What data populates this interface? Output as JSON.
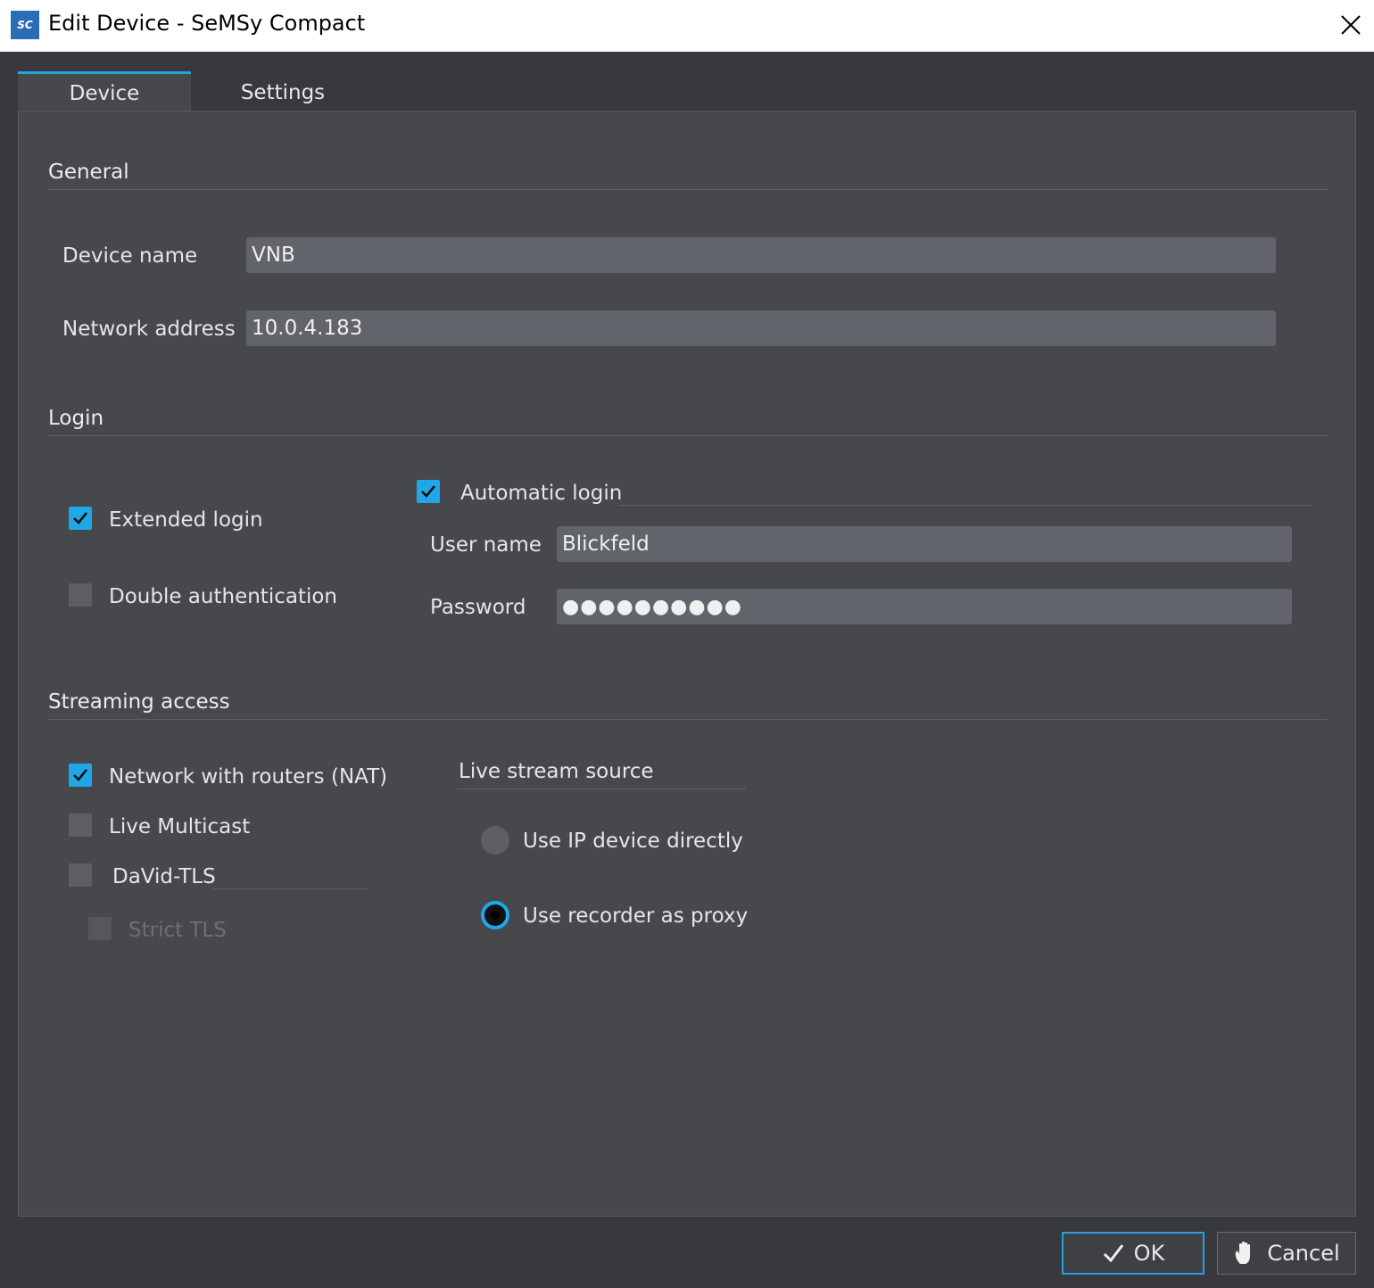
{
  "window": {
    "app_icon_text": "SC",
    "title": "Edit Device - SeMSy Compact"
  },
  "tabs": [
    {
      "label": "Device",
      "active": true
    },
    {
      "label": "Settings",
      "active": false
    }
  ],
  "general": {
    "title": "General",
    "device_name_label": "Device name",
    "device_name_value": "VNB",
    "network_address_label": "Network address",
    "network_address_value": "10.0.4.183"
  },
  "login": {
    "title": "Login",
    "extended_login": {
      "label": "Extended login",
      "checked": true
    },
    "double_authentication": {
      "label": "Double authentication",
      "checked": false
    },
    "automatic_login": {
      "label": "Automatic login",
      "checked": true
    },
    "user_name_label": "User name",
    "user_name_value": "Blickfeld",
    "password_label": "Password",
    "password_value": "●●●●●●●●●●"
  },
  "streaming": {
    "title": "Streaming access",
    "nat": {
      "label": "Network with routers (NAT)",
      "checked": true
    },
    "live_multicast": {
      "label": "Live Multicast",
      "checked": false
    },
    "david_tls": {
      "label": "DaVid-TLS",
      "checked": false
    },
    "strict_tls": {
      "label": "Strict TLS",
      "checked": false,
      "disabled": true
    },
    "live_stream_source_title": "Live stream source",
    "use_ip_device": {
      "label": "Use IP device directly",
      "selected": false
    },
    "use_recorder_proxy": {
      "label": "Use recorder as proxy",
      "selected": true
    }
  },
  "buttons": {
    "ok_label": "OK",
    "cancel_label": "Cancel"
  },
  "colors": {
    "accent": "#1fa7e8",
    "background": "#38393c",
    "panel": "#47484c",
    "field": "#62646b"
  }
}
